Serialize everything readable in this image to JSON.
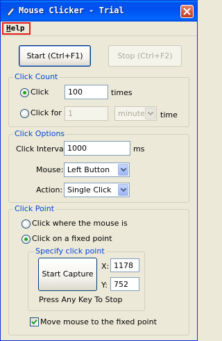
{
  "window": {
    "title": "Mouse Clicker - Trial"
  },
  "menu": {
    "help_prefix": "H",
    "help_rest": "elp"
  },
  "toolbar": {
    "start_label": "Start (Ctrl+F1)",
    "stop_label": "Stop (Ctrl+F2)"
  },
  "click_count": {
    "title": "Click Count",
    "click_label": "Click",
    "click_value": "100",
    "times_label": "times",
    "click_for_label": "Click for",
    "click_for_value": "1",
    "unit_selected": "minute",
    "time_label": "time"
  },
  "click_options": {
    "title": "Click Options",
    "interval_label": "Click Interval:",
    "interval_value": "1000",
    "interval_unit": "ms",
    "mouse_label": "Mouse:",
    "mouse_selected": "Left Button",
    "action_label": "Action:",
    "action_selected": "Single Click"
  },
  "click_point": {
    "title": "Click Point",
    "where_mouse_label": "Click where the mouse is",
    "fixed_point_label": "Click on a fixed point",
    "specify_title": "Specify click point",
    "capture_label": "Start Capture",
    "x_label": "X:",
    "x_value": "1178",
    "y_label": "Y:",
    "y_value": "752",
    "hint": "Press Any Key To Stop",
    "move_mouse_label": "Move mouse to the fixed point"
  },
  "colors": {
    "accent": "#0046d5",
    "highlight": "#e21b1b",
    "titlebar": "#0054e3"
  }
}
